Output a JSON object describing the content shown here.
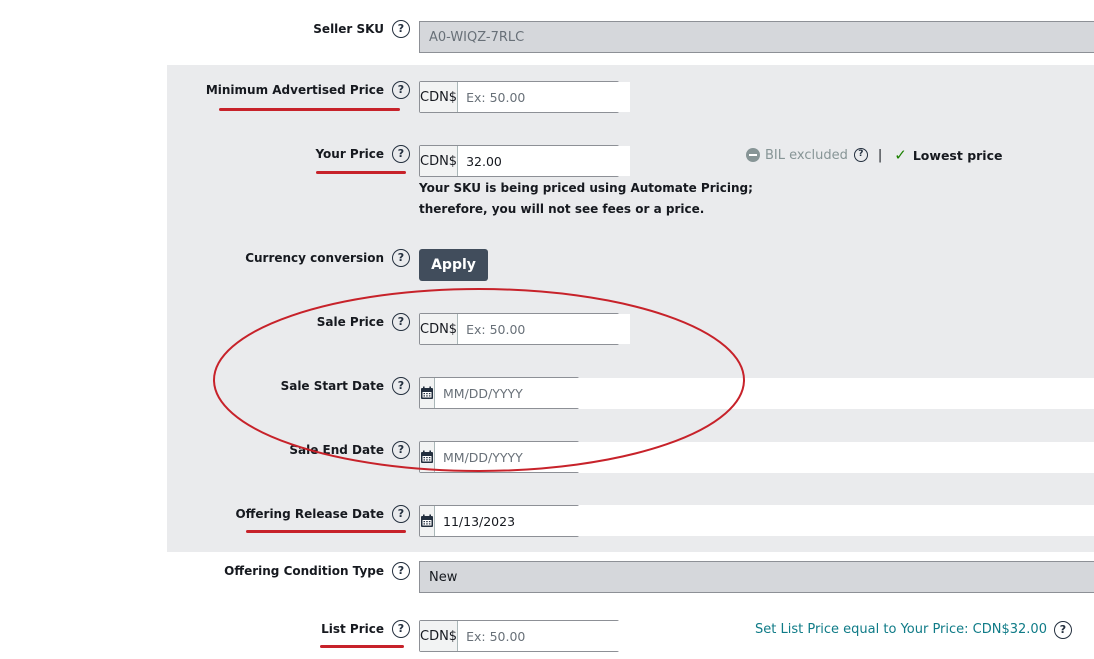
{
  "fields": {
    "seller_sku": {
      "label": "Seller SKU",
      "value": "A0-WIQZ-7RLC"
    },
    "map": {
      "label": "Minimum Advertised Price",
      "currency": "CDN$",
      "placeholder": "Ex: 50.00",
      "value": ""
    },
    "your_price": {
      "label": "Your Price",
      "currency": "CDN$",
      "value": "32.00",
      "note_line1": "Your SKU is being priced using Automate Pricing;",
      "note_line2": "therefore, you will not see fees or a price."
    },
    "currency_conversion": {
      "label": "Currency conversion",
      "button": "Apply"
    },
    "sale_price": {
      "label": "Sale Price",
      "currency": "CDN$",
      "placeholder": "Ex: 50.00"
    },
    "sale_start": {
      "label": "Sale Start Date",
      "placeholder": "MM/DD/YYYY"
    },
    "sale_end": {
      "label": "Sale End Date",
      "placeholder": "MM/DD/YYYY"
    },
    "release_date": {
      "label": "Offering Release Date",
      "value": "11/13/2023"
    },
    "condition": {
      "label": "Offering Condition Type",
      "value": "New"
    },
    "list_price": {
      "label": "List Price",
      "currency": "CDN$",
      "placeholder": "Ex: 50.00"
    }
  },
  "status": {
    "bil": "BIL excluded",
    "separator": "|",
    "lowest": "Lowest price"
  },
  "set_list_price_link": "Set List Price equal to Your Price: CDN$32.00",
  "help_glyph": "?",
  "annotation_color": "#c7222a"
}
